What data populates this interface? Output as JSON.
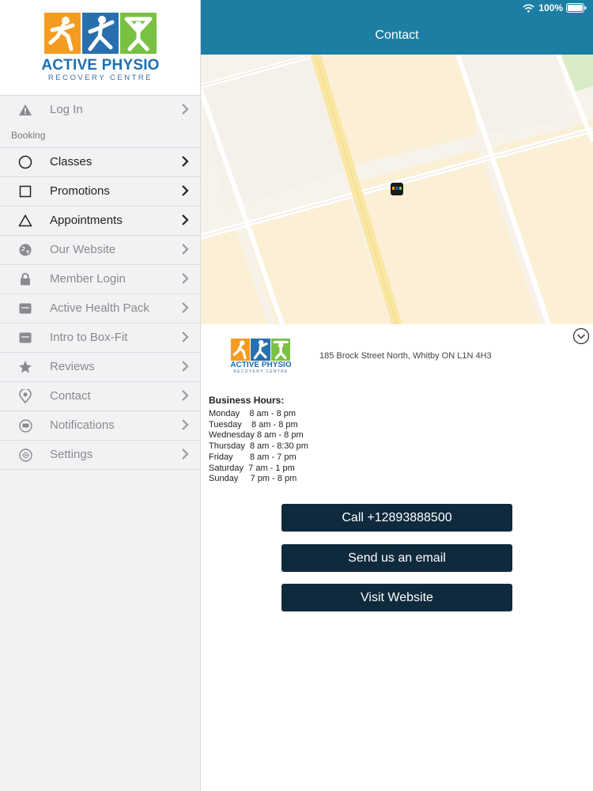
{
  "status_bar": {
    "battery": "100%"
  },
  "header": {
    "title": "Contact"
  },
  "logo": {
    "name": "ACTIVE PHYSIO",
    "subtitle": "RECOVERY CENTRE"
  },
  "sidebar": {
    "section_booking": "Booking",
    "items": [
      {
        "label": "Log In",
        "icon": "warning-icon"
      },
      {
        "label": "Classes",
        "icon": "circle-icon"
      },
      {
        "label": "Promotions",
        "icon": "square-icon"
      },
      {
        "label": "Appointments",
        "icon": "triangle-icon"
      },
      {
        "label": "Our Website",
        "icon": "globe-icon"
      },
      {
        "label": "Member Login",
        "icon": "lock-icon"
      },
      {
        "label": "Active Health Pack",
        "icon": "envelope-icon"
      },
      {
        "label": "Intro to Box-Fit",
        "icon": "envelope-icon"
      },
      {
        "label": "Reviews",
        "icon": "star-icon"
      },
      {
        "label": "Contact",
        "icon": "location-pin-icon"
      },
      {
        "label": "Notifications",
        "icon": "chat-bubble-icon"
      },
      {
        "label": "Settings",
        "icon": "gear-icon"
      }
    ]
  },
  "contact": {
    "address": "185 Brock Street North, Whitby ON L1N 4H3",
    "hours_title": "Business Hours:",
    "hours": [
      {
        "day": "Monday",
        "time": "8 am - 8 pm"
      },
      {
        "day": "Tuesday",
        "time": "8 am - 8 pm"
      },
      {
        "day": "Wednesday",
        "time": "8 am - 8 pm"
      },
      {
        "day": "Thursday",
        "time": "8 am - 8:30 pm"
      },
      {
        "day": "Friday",
        "time": "8 am - 7 pm"
      },
      {
        "day": "Saturday",
        "time": "7 am - 1 pm"
      },
      {
        "day": "Sunday",
        "time": "7 pm - 8 pm"
      }
    ],
    "buttons": {
      "call": "Call +12893888500",
      "email": "Send us an email",
      "website": "Visit Website"
    }
  },
  "colors": {
    "header": "#1d7ea3",
    "button": "#0f2a3d",
    "logo_orange": "#f39c1f",
    "logo_blue": "#2a6fad",
    "logo_green": "#7ac143"
  }
}
